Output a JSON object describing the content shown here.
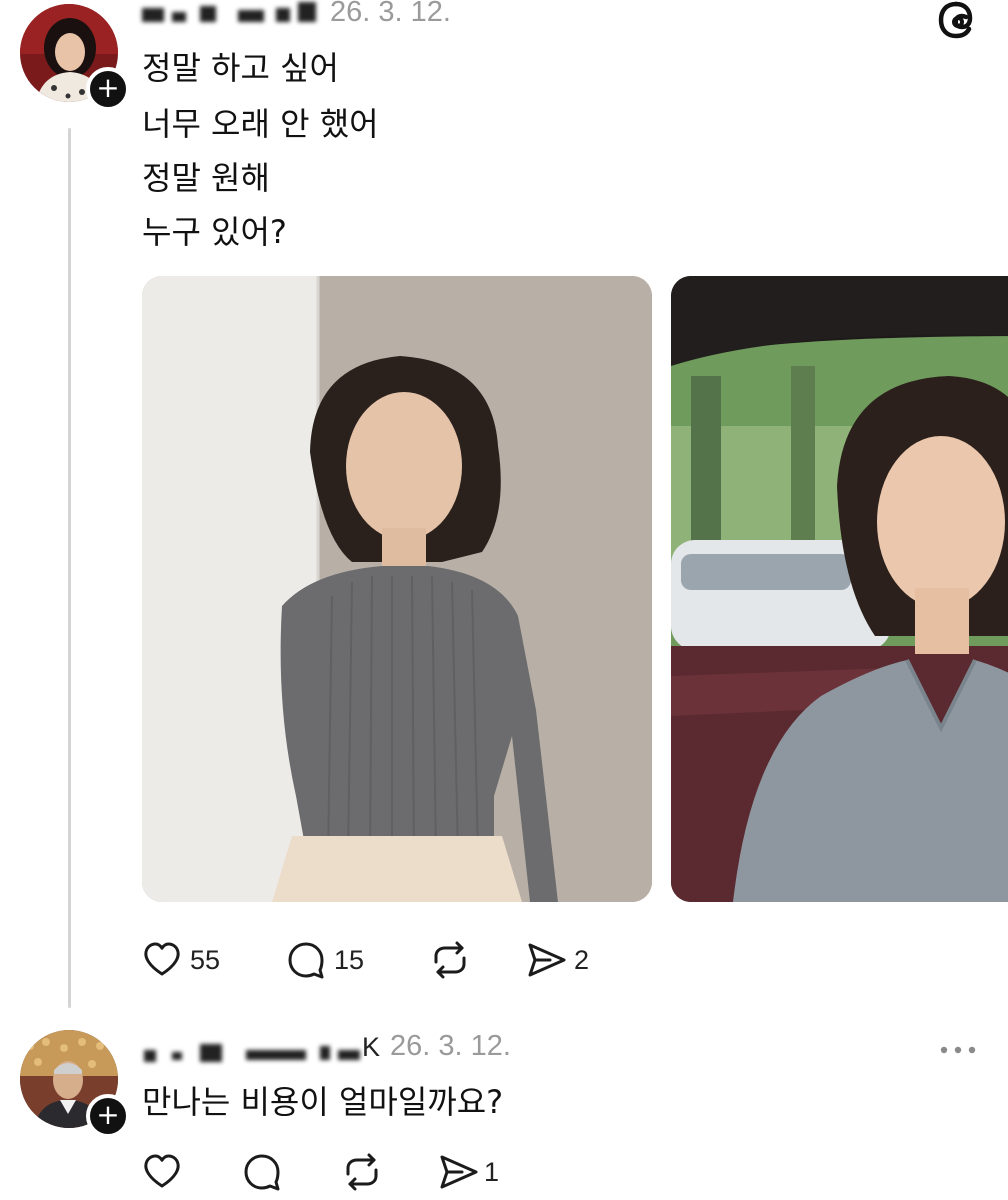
{
  "post": {
    "timestamp": "26. 3. 12.",
    "lines": [
      "정말 하고 싶어",
      "너무 오래 안 했어",
      "정말 원해",
      "누구 있어?"
    ],
    "actions": {
      "likes": "55",
      "comments": "15",
      "shares": "2"
    }
  },
  "reply": {
    "name_tail": "K",
    "timestamp": "26. 3. 12.",
    "text": "만나는 비용이 얼마일까요?",
    "actions": {
      "shares": "1"
    }
  },
  "icons": {
    "brand": "threads-logo-icon",
    "like": "heart-icon",
    "comment": "speech-bubble-icon",
    "repost": "repost-arrows-icon",
    "share": "send-icon",
    "more": "more-dots-icon",
    "follow": "plus-icon"
  }
}
